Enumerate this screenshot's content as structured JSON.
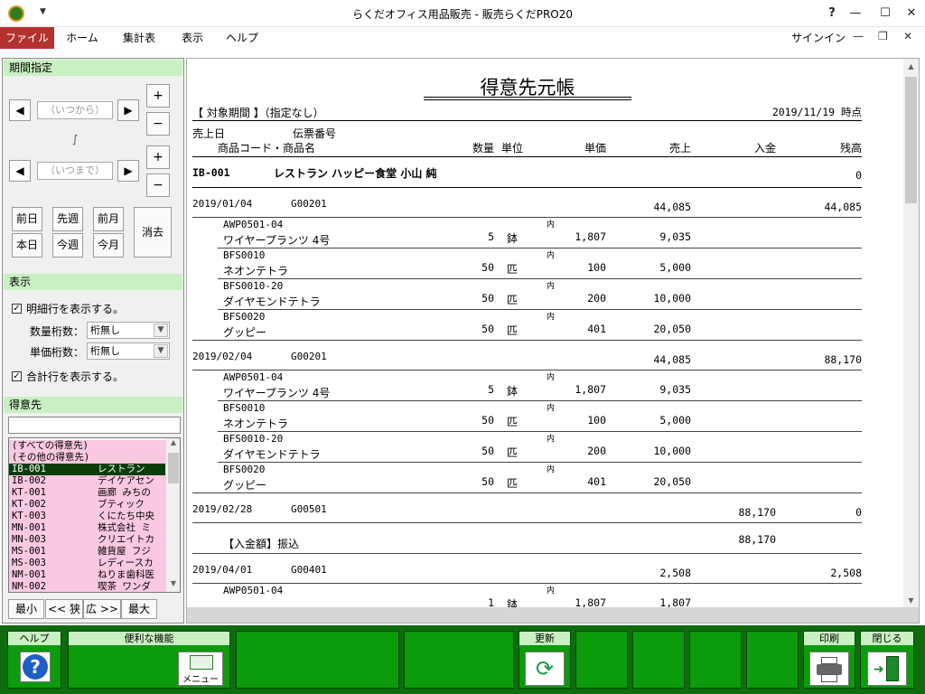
{
  "window": {
    "title": "らくだオフィス用品販売 - 販売らくだPRO20",
    "help": "?",
    "minimize": "—",
    "maximize": "☐",
    "close": "✕",
    "app_icon": "camel-app-icon",
    "qa": "▼"
  },
  "menu": {
    "items": [
      "ファイル",
      "ホーム",
      "集計表",
      "表示",
      "ヘルプ"
    ],
    "signin": "サインイン",
    "min": "—",
    "restore": "❐",
    "close": "✕"
  },
  "period": {
    "title": "期間指定",
    "from_placeholder": "（いつから）",
    "to_placeholder": "（いつまで）",
    "tilde": "∫",
    "plus": "+",
    "minus": "−",
    "prev": "◀",
    "next": "▶",
    "quick": [
      "前日",
      "先週",
      "前月",
      "本日",
      "今週",
      "今月"
    ],
    "clear": "消去"
  },
  "display": {
    "title": "表示",
    "show_detail": "明細行を表示する。",
    "qty_digits_label": "数量桁数：",
    "qty_digits_value": "桁無し",
    "price_digits_label": "単価桁数：",
    "price_digits_value": "桁無し",
    "show_total": "合計行を表示する。",
    "check": "✓"
  },
  "customer": {
    "title": "得意先",
    "items": [
      {
        "code": "(すべての得意先)",
        "name": ""
      },
      {
        "code": "(その他の得意先)",
        "name": ""
      },
      {
        "code": "IB-001",
        "name": "レストラン"
      },
      {
        "code": "IB-002",
        "name": "デイケアセン"
      },
      {
        "code": "KT-001",
        "name": "画廊 みちの"
      },
      {
        "code": "KT-002",
        "name": "ブティック"
      },
      {
        "code": "KT-003",
        "name": "くにたち中央"
      },
      {
        "code": "MN-001",
        "name": "株式会社 ミ"
      },
      {
        "code": "MN-003",
        "name": "クリエイトカ"
      },
      {
        "code": "MS-001",
        "name": "雑貨屋 フジ"
      },
      {
        "code": "MS-003",
        "name": "レディースカ"
      },
      {
        "code": "NM-001",
        "name": "ねりま歯科医"
      },
      {
        "code": "NM-002",
        "name": "喫茶 ワンダ"
      }
    ],
    "selected": 2,
    "size_buttons": [
      "最小",
      "<< 狭",
      "広 >>",
      "最大"
    ]
  },
  "report": {
    "title": "得意先元帳",
    "period_label": "【 対象期間 】（指定なし）",
    "as_of": "2019/11/19 時点",
    "headers": {
      "sale_date": "売上日",
      "slip_no": "伝票番号",
      "item": "商品コード・商品名",
      "qty": "数量",
      "unit": "単位",
      "price": "単価",
      "sales": "売上",
      "payment": "入金",
      "balance": "残高"
    },
    "customer_code": "IB-001",
    "customer_name": "レストラン ハッピー食堂 小山 純",
    "opening_balance": "0",
    "tax_mark": "内",
    "blocks": [
      {
        "date": "2019/01/04",
        "slip": "G00201",
        "sales": "44,085",
        "payment": "",
        "balance": "44,085",
        "lines": [
          {
            "code": "AWP0501-04",
            "name": "ワイヤープランツ 4号",
            "qty": "5",
            "unit": "鉢",
            "price": "1,807",
            "amount": "9,035"
          },
          {
            "code": "BFS0010",
            "name": "ネオンテトラ",
            "qty": "50",
            "unit": "匹",
            "price": "100",
            "amount": "5,000"
          },
          {
            "code": "BFS0010-20",
            "name": "ダイヤモンドテトラ",
            "qty": "50",
            "unit": "匹",
            "price": "200",
            "amount": "10,000"
          },
          {
            "code": "BFS0020",
            "name": "グッピー",
            "qty": "50",
            "unit": "匹",
            "price": "401",
            "amount": "20,050"
          }
        ]
      },
      {
        "date": "2019/02/04",
        "slip": "G00201",
        "sales": "44,085",
        "payment": "",
        "balance": "88,170",
        "lines": [
          {
            "code": "AWP0501-04",
            "name": "ワイヤープランツ 4号",
            "qty": "5",
            "unit": "鉢",
            "price": "1,807",
            "amount": "9,035"
          },
          {
            "code": "BFS0010",
            "name": "ネオンテトラ",
            "qty": "50",
            "unit": "匹",
            "price": "100",
            "amount": "5,000"
          },
          {
            "code": "BFS0010-20",
            "name": "ダイヤモンドテトラ",
            "qty": "50",
            "unit": "匹",
            "price": "200",
            "amount": "10,000"
          },
          {
            "code": "BFS0020",
            "name": "グッピー",
            "qty": "50",
            "unit": "匹",
            "price": "401",
            "amount": "20,050"
          }
        ]
      }
    ],
    "payment_block": {
      "date": "2019/02/28",
      "slip": "G00501",
      "payment": "88,170",
      "balance": "0",
      "line_label": "【入金額】振込",
      "line_amount": "88,170"
    },
    "last_block": {
      "date": "2019/04/01",
      "slip": "G00401",
      "sales": "2,508",
      "balance": "2,508",
      "code": "AWP0501-04",
      "qty": "1",
      "unit": "鉢",
      "price": "1,807",
      "amount": "1,807"
    }
  },
  "toolbar": {
    "help": "ヘルプ",
    "help_icon": "?",
    "convenient": "便利な機能",
    "menu_label": "メニュー",
    "refresh": "更新",
    "print": "印刷",
    "close": "閉じる"
  }
}
